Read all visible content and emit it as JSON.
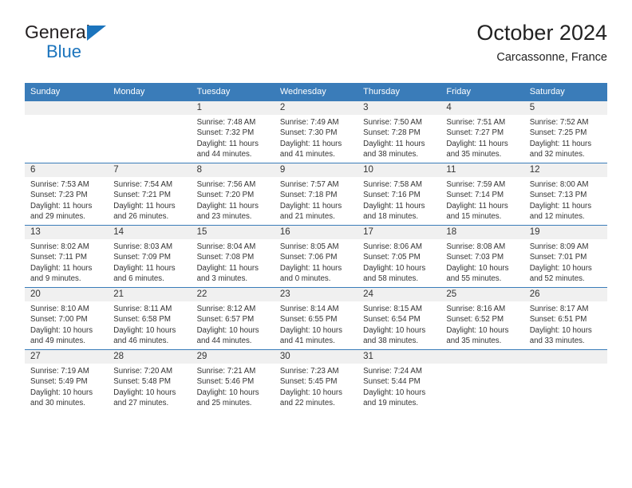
{
  "brand": {
    "line1": "General",
    "line2": "Blue",
    "triangle_color": "#1b74bd"
  },
  "header": {
    "title": "October 2024",
    "subtitle": "Carcassonne, France"
  },
  "theme": {
    "header_blue": "#3a7cb9",
    "band_gray": "#f0f0f0",
    "text": "#333333"
  },
  "calendar": {
    "weekday_headers": [
      "Sunday",
      "Monday",
      "Tuesday",
      "Wednesday",
      "Thursday",
      "Friday",
      "Saturday"
    ],
    "weeks": [
      [
        {
          "day": "",
          "sunrise": "",
          "sunset": "",
          "daylight": ""
        },
        {
          "day": "",
          "sunrise": "",
          "sunset": "",
          "daylight": ""
        },
        {
          "day": "1",
          "sunrise": "Sunrise: 7:48 AM",
          "sunset": "Sunset: 7:32 PM",
          "daylight": "Daylight: 11 hours and 44 minutes."
        },
        {
          "day": "2",
          "sunrise": "Sunrise: 7:49 AM",
          "sunset": "Sunset: 7:30 PM",
          "daylight": "Daylight: 11 hours and 41 minutes."
        },
        {
          "day": "3",
          "sunrise": "Sunrise: 7:50 AM",
          "sunset": "Sunset: 7:28 PM",
          "daylight": "Daylight: 11 hours and 38 minutes."
        },
        {
          "day": "4",
          "sunrise": "Sunrise: 7:51 AM",
          "sunset": "Sunset: 7:27 PM",
          "daylight": "Daylight: 11 hours and 35 minutes."
        },
        {
          "day": "5",
          "sunrise": "Sunrise: 7:52 AM",
          "sunset": "Sunset: 7:25 PM",
          "daylight": "Daylight: 11 hours and 32 minutes."
        }
      ],
      [
        {
          "day": "6",
          "sunrise": "Sunrise: 7:53 AM",
          "sunset": "Sunset: 7:23 PM",
          "daylight": "Daylight: 11 hours and 29 minutes."
        },
        {
          "day": "7",
          "sunrise": "Sunrise: 7:54 AM",
          "sunset": "Sunset: 7:21 PM",
          "daylight": "Daylight: 11 hours and 26 minutes."
        },
        {
          "day": "8",
          "sunrise": "Sunrise: 7:56 AM",
          "sunset": "Sunset: 7:20 PM",
          "daylight": "Daylight: 11 hours and 23 minutes."
        },
        {
          "day": "9",
          "sunrise": "Sunrise: 7:57 AM",
          "sunset": "Sunset: 7:18 PM",
          "daylight": "Daylight: 11 hours and 21 minutes."
        },
        {
          "day": "10",
          "sunrise": "Sunrise: 7:58 AM",
          "sunset": "Sunset: 7:16 PM",
          "daylight": "Daylight: 11 hours and 18 minutes."
        },
        {
          "day": "11",
          "sunrise": "Sunrise: 7:59 AM",
          "sunset": "Sunset: 7:14 PM",
          "daylight": "Daylight: 11 hours and 15 minutes."
        },
        {
          "day": "12",
          "sunrise": "Sunrise: 8:00 AM",
          "sunset": "Sunset: 7:13 PM",
          "daylight": "Daylight: 11 hours and 12 minutes."
        }
      ],
      [
        {
          "day": "13",
          "sunrise": "Sunrise: 8:02 AM",
          "sunset": "Sunset: 7:11 PM",
          "daylight": "Daylight: 11 hours and 9 minutes."
        },
        {
          "day": "14",
          "sunrise": "Sunrise: 8:03 AM",
          "sunset": "Sunset: 7:09 PM",
          "daylight": "Daylight: 11 hours and 6 minutes."
        },
        {
          "day": "15",
          "sunrise": "Sunrise: 8:04 AM",
          "sunset": "Sunset: 7:08 PM",
          "daylight": "Daylight: 11 hours and 3 minutes."
        },
        {
          "day": "16",
          "sunrise": "Sunrise: 8:05 AM",
          "sunset": "Sunset: 7:06 PM",
          "daylight": "Daylight: 11 hours and 0 minutes."
        },
        {
          "day": "17",
          "sunrise": "Sunrise: 8:06 AM",
          "sunset": "Sunset: 7:05 PM",
          "daylight": "Daylight: 10 hours and 58 minutes."
        },
        {
          "day": "18",
          "sunrise": "Sunrise: 8:08 AM",
          "sunset": "Sunset: 7:03 PM",
          "daylight": "Daylight: 10 hours and 55 minutes."
        },
        {
          "day": "19",
          "sunrise": "Sunrise: 8:09 AM",
          "sunset": "Sunset: 7:01 PM",
          "daylight": "Daylight: 10 hours and 52 minutes."
        }
      ],
      [
        {
          "day": "20",
          "sunrise": "Sunrise: 8:10 AM",
          "sunset": "Sunset: 7:00 PM",
          "daylight": "Daylight: 10 hours and 49 minutes."
        },
        {
          "day": "21",
          "sunrise": "Sunrise: 8:11 AM",
          "sunset": "Sunset: 6:58 PM",
          "daylight": "Daylight: 10 hours and 46 minutes."
        },
        {
          "day": "22",
          "sunrise": "Sunrise: 8:12 AM",
          "sunset": "Sunset: 6:57 PM",
          "daylight": "Daylight: 10 hours and 44 minutes."
        },
        {
          "day": "23",
          "sunrise": "Sunrise: 8:14 AM",
          "sunset": "Sunset: 6:55 PM",
          "daylight": "Daylight: 10 hours and 41 minutes."
        },
        {
          "day": "24",
          "sunrise": "Sunrise: 8:15 AM",
          "sunset": "Sunset: 6:54 PM",
          "daylight": "Daylight: 10 hours and 38 minutes."
        },
        {
          "day": "25",
          "sunrise": "Sunrise: 8:16 AM",
          "sunset": "Sunset: 6:52 PM",
          "daylight": "Daylight: 10 hours and 35 minutes."
        },
        {
          "day": "26",
          "sunrise": "Sunrise: 8:17 AM",
          "sunset": "Sunset: 6:51 PM",
          "daylight": "Daylight: 10 hours and 33 minutes."
        }
      ],
      [
        {
          "day": "27",
          "sunrise": "Sunrise: 7:19 AM",
          "sunset": "Sunset: 5:49 PM",
          "daylight": "Daylight: 10 hours and 30 minutes."
        },
        {
          "day": "28",
          "sunrise": "Sunrise: 7:20 AM",
          "sunset": "Sunset: 5:48 PM",
          "daylight": "Daylight: 10 hours and 27 minutes."
        },
        {
          "day": "29",
          "sunrise": "Sunrise: 7:21 AM",
          "sunset": "Sunset: 5:46 PM",
          "daylight": "Daylight: 10 hours and 25 minutes."
        },
        {
          "day": "30",
          "sunrise": "Sunrise: 7:23 AM",
          "sunset": "Sunset: 5:45 PM",
          "daylight": "Daylight: 10 hours and 22 minutes."
        },
        {
          "day": "31",
          "sunrise": "Sunrise: 7:24 AM",
          "sunset": "Sunset: 5:44 PM",
          "daylight": "Daylight: 10 hours and 19 minutes."
        },
        {
          "day": "",
          "sunrise": "",
          "sunset": "",
          "daylight": ""
        },
        {
          "day": "",
          "sunrise": "",
          "sunset": "",
          "daylight": ""
        }
      ]
    ]
  }
}
